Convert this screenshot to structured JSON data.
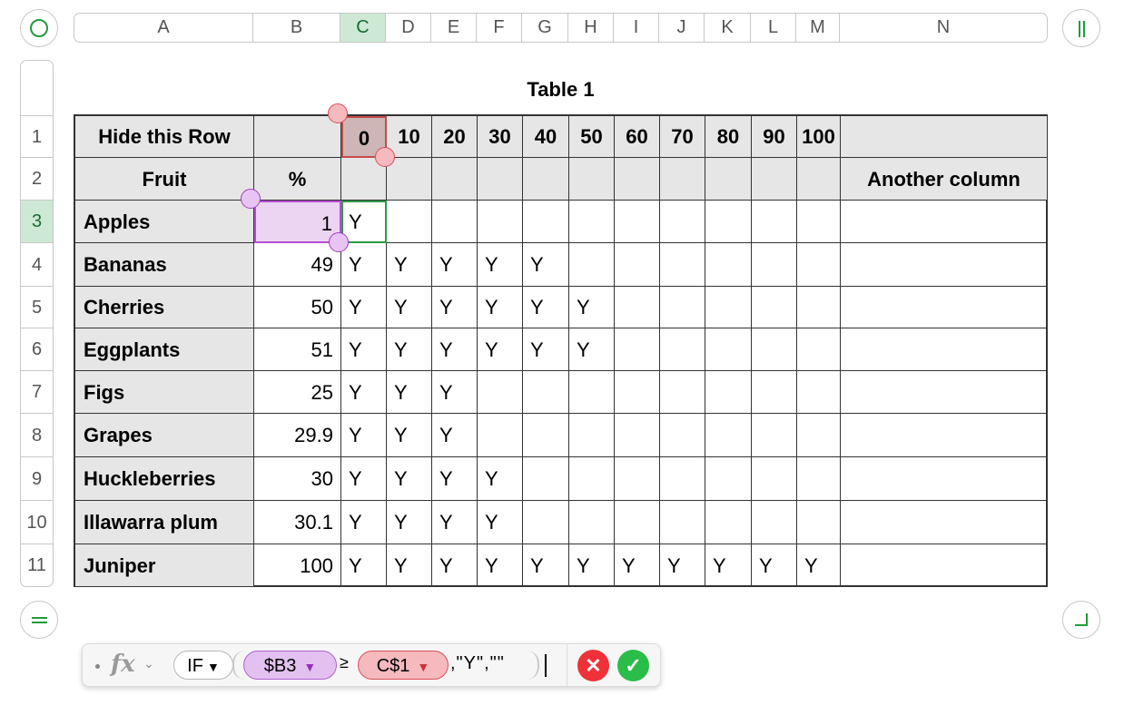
{
  "columns": [
    "A",
    "B",
    "C",
    "D",
    "E",
    "F",
    "G",
    "H",
    "I",
    "J",
    "K",
    "L",
    "M",
    "N"
  ],
  "selected_column": "C",
  "rows": [
    "1",
    "2",
    "3",
    "4",
    "5",
    "6",
    "7",
    "8",
    "9",
    "10",
    "11"
  ],
  "selected_row": "3",
  "table_title": "Table 1",
  "row1": {
    "label": "Hide this Row",
    "thresholds": [
      "0",
      "10",
      "20",
      "30",
      "40",
      "50",
      "60",
      "70",
      "80",
      "90",
      "100"
    ]
  },
  "row2": {
    "fruit_header": "Fruit",
    "pct_header": "%",
    "another_header": "Another column"
  },
  "data_rows": [
    {
      "fruit": "Apples",
      "pct": "1",
      "marks": [
        "Y",
        "",
        "",
        "",
        "",
        "",
        "",
        "",
        "",
        "",
        ""
      ]
    },
    {
      "fruit": "Bananas",
      "pct": "49",
      "marks": [
        "Y",
        "Y",
        "Y",
        "Y",
        "Y",
        "",
        "",
        "",
        "",
        "",
        ""
      ]
    },
    {
      "fruit": "Cherries",
      "pct": "50",
      "marks": [
        "Y",
        "Y",
        "Y",
        "Y",
        "Y",
        "Y",
        "",
        "",
        "",
        "",
        ""
      ]
    },
    {
      "fruit": "Eggplants",
      "pct": "51",
      "marks": [
        "Y",
        "Y",
        "Y",
        "Y",
        "Y",
        "Y",
        "",
        "",
        "",
        "",
        ""
      ]
    },
    {
      "fruit": "Figs",
      "pct": "25",
      "marks": [
        "Y",
        "Y",
        "Y",
        "",
        "",
        "",
        "",
        "",
        "",
        "",
        ""
      ]
    },
    {
      "fruit": "Grapes",
      "pct": "29.9",
      "marks": [
        "Y",
        "Y",
        "Y",
        "",
        "",
        "",
        "",
        "",
        "",
        "",
        ""
      ]
    },
    {
      "fruit": "Huckleberries",
      "pct": "30",
      "marks": [
        "Y",
        "Y",
        "Y",
        "Y",
        "",
        "",
        "",
        "",
        "",
        "",
        ""
      ]
    },
    {
      "fruit": "Illawarra plum",
      "pct": "30.1",
      "marks": [
        "Y",
        "Y",
        "Y",
        "Y",
        "",
        "",
        "",
        "",
        "",
        "",
        ""
      ]
    },
    {
      "fruit": "Juniper",
      "pct": "100",
      "marks": [
        "Y",
        "Y",
        "Y",
        "Y",
        "Y",
        "Y",
        "Y",
        "Y",
        "Y",
        "Y",
        "Y"
      ]
    }
  ],
  "formula": {
    "fx": "fx",
    "func": "IF",
    "ref1": "$B3",
    "operator": "≥",
    "ref2": "C$1",
    "tail": ",\"Y\",\"\""
  },
  "colors": {
    "selection_green": "#1f9d3a",
    "ref_purple": "#b061cc",
    "ref_red": "#d9505a"
  },
  "icons": [
    "select-all-icon",
    "pause-icon",
    "add-row-icon",
    "resize-icon",
    "fx-icon",
    "cancel-icon",
    "accept-icon"
  ]
}
